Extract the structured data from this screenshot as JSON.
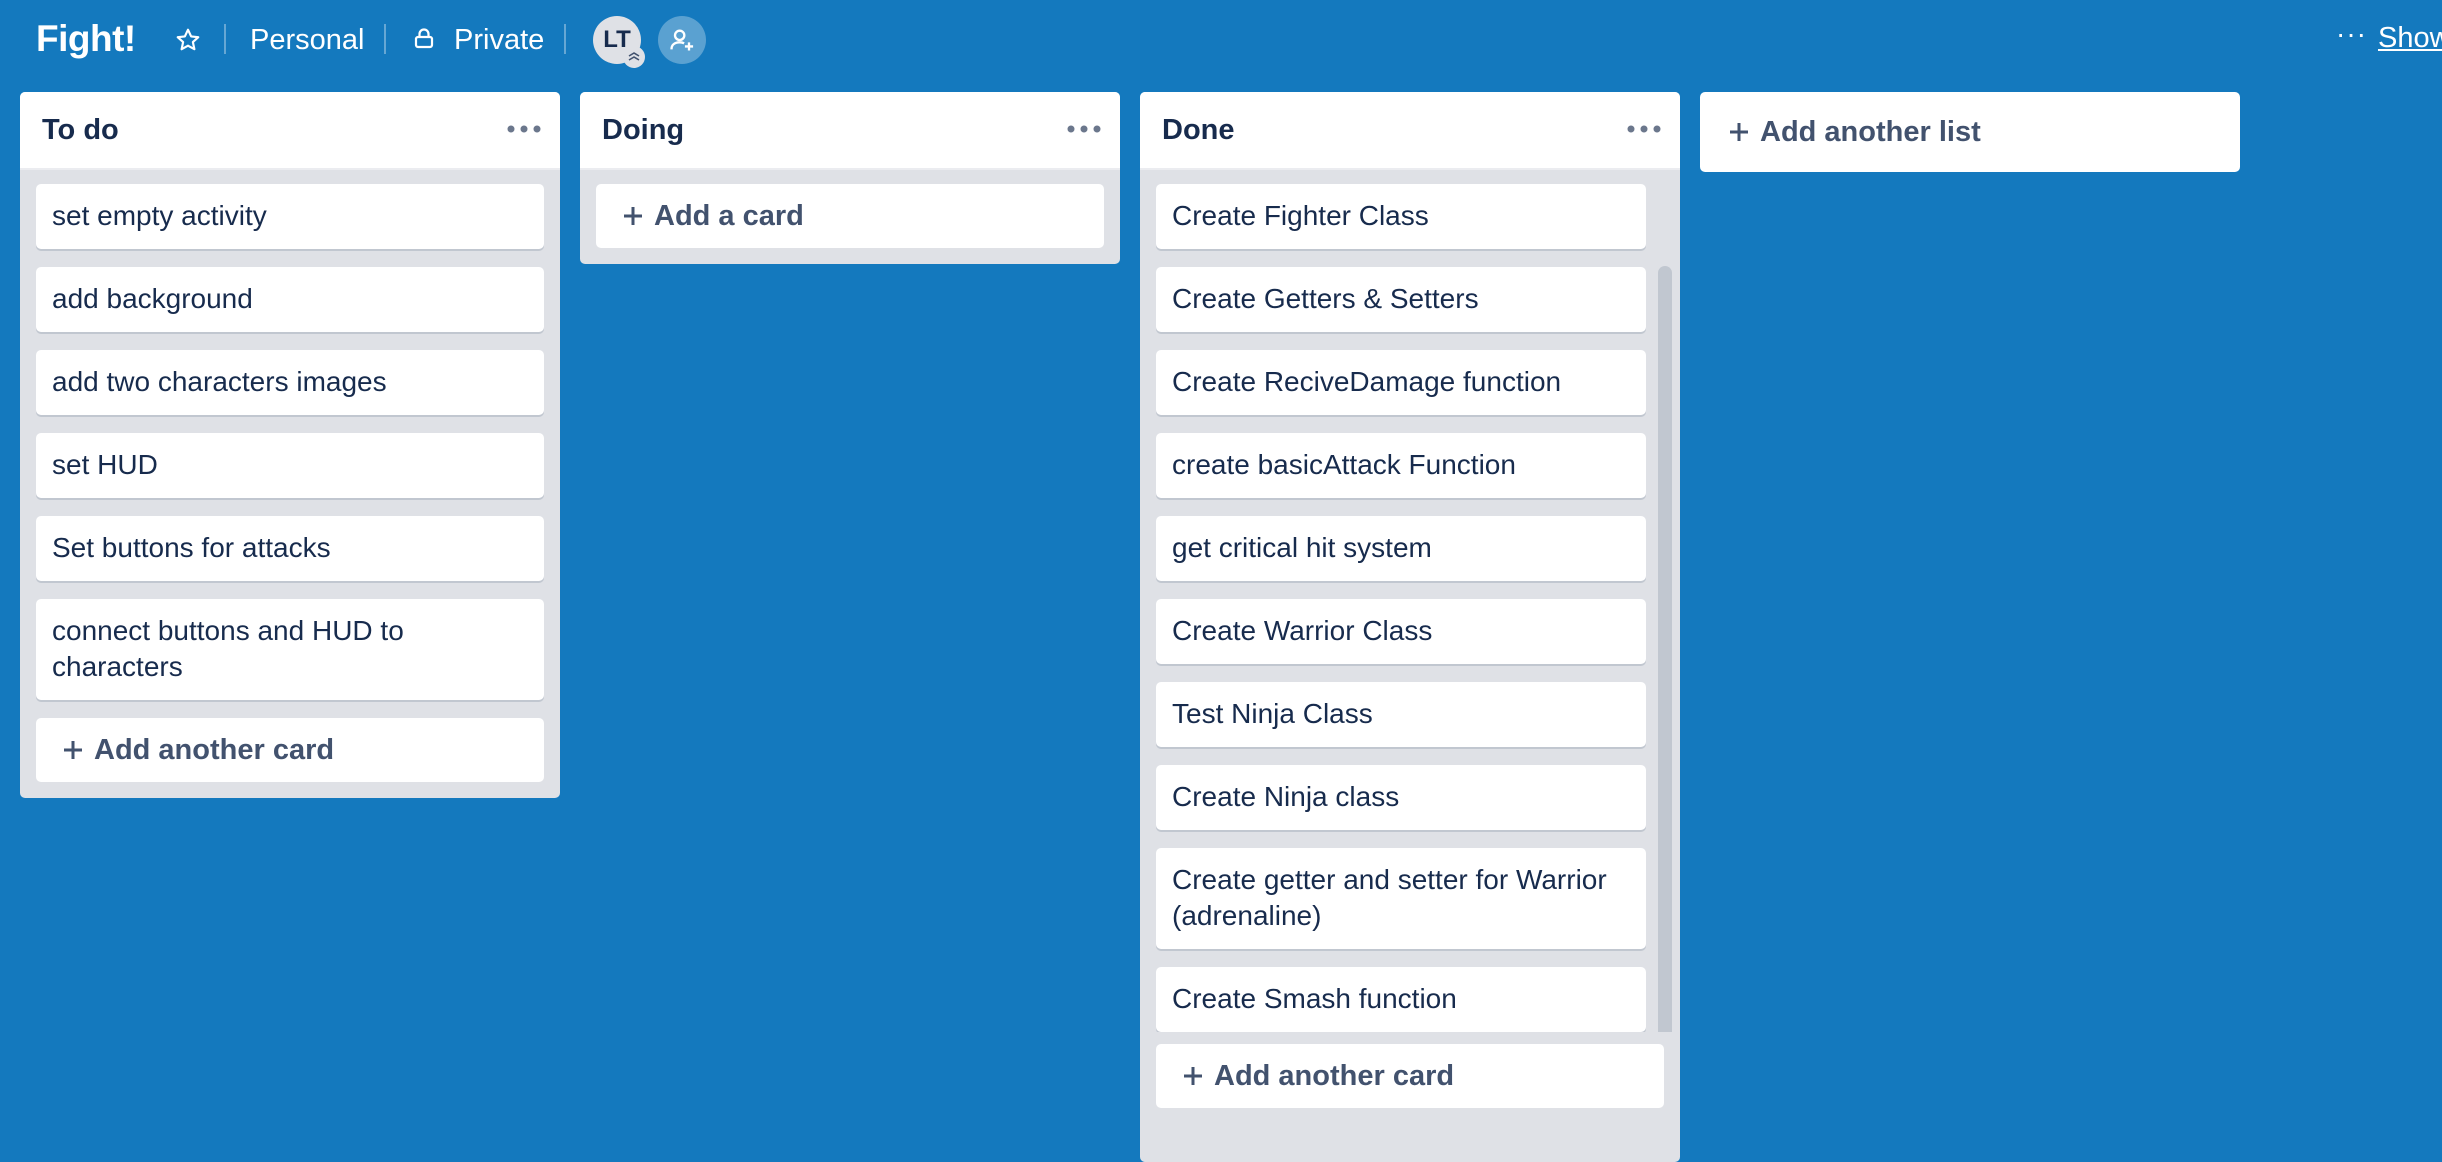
{
  "board": {
    "title": "Fight!",
    "team": "Personal",
    "visibility": "Private",
    "member_initials": "LT",
    "menu_ellipsis": "···",
    "show_menu_label": "Show"
  },
  "lists": [
    {
      "title": "To do",
      "cards": [
        "set empty activity",
        "add background",
        "add two characters images",
        "set HUD",
        "Set buttons for attacks",
        "connect buttons and HUD to characters"
      ],
      "add_label": "Add another card"
    },
    {
      "title": "Doing",
      "cards": [],
      "add_label": "Add a card"
    },
    {
      "title": "Done",
      "cards": [
        "Create Fighter Class",
        "Create Getters & Setters",
        "Create ReciveDamage function",
        "create basicAttack Function",
        "get critical hit system",
        "Create Warrior Class",
        "Test Ninja Class",
        "Create Ninja class",
        "Create getter and setter for Warrior (adrenaline)",
        "Create Smash function"
      ],
      "add_label": "Add another card"
    }
  ],
  "add_list_label": "Add another list",
  "icons": {
    "star": "star-icon",
    "lock": "lock-icon",
    "invite": "add-member-icon",
    "list_menu": "more-horizontal-icon",
    "plus": "plus-icon"
  },
  "colors": {
    "board_background": "#1479be",
    "list_background": "#dfe1e6",
    "card_background": "#ffffff",
    "text": "#172b4d",
    "muted_text": "#42526e"
  }
}
